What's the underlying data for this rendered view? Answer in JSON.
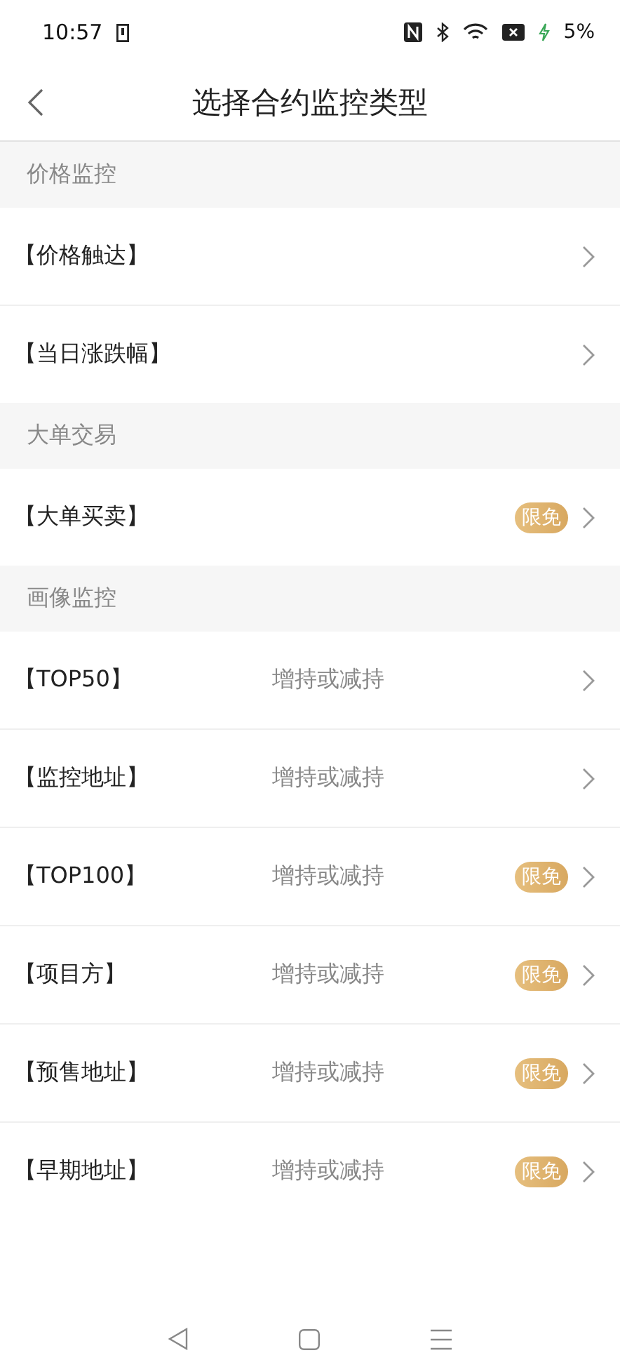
{
  "status_bar": {
    "time": "10:57",
    "battery": "5%"
  },
  "header": {
    "title": "选择合约监控类型"
  },
  "sections": [
    {
      "title": "价格监控",
      "items": [
        {
          "label": "【价格触达】"
        },
        {
          "label": "【当日涨跌幅】"
        }
      ]
    },
    {
      "title": "大单交易",
      "items": [
        {
          "label": "【大单买卖】",
          "badge": "限免"
        }
      ]
    },
    {
      "title": "画像监控",
      "items": [
        {
          "label": "【TOP50】",
          "subtitle": "增持或减持"
        },
        {
          "label": "【监控地址】",
          "subtitle": "增持或减持"
        },
        {
          "label": "【TOP100】",
          "subtitle": "增持或减持",
          "badge": "限免"
        },
        {
          "label": "【项目方】",
          "subtitle": "增持或减持",
          "badge": "限免"
        },
        {
          "label": "【预售地址】",
          "subtitle": "增持或减持",
          "badge": "限免"
        },
        {
          "label": "【早期地址】",
          "subtitle": "增持或减持",
          "badge": "限免"
        }
      ]
    }
  ]
}
